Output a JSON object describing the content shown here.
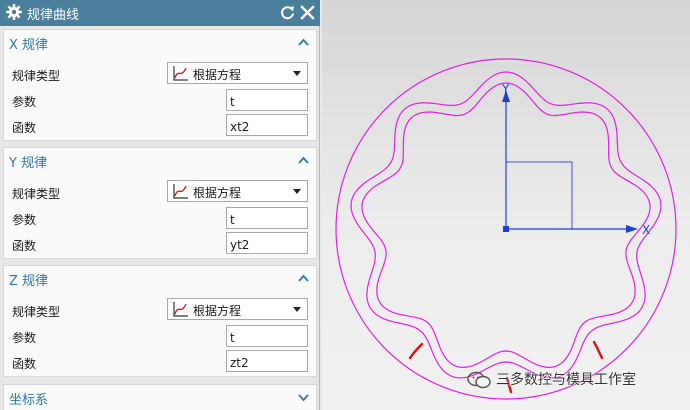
{
  "dialog": {
    "title": "规律曲线",
    "icons": {
      "settings": "gear-icon",
      "reset": "reset-icon",
      "close": "close-icon"
    }
  },
  "sections": [
    {
      "title": "X 规律",
      "law_type_label": "规律类型",
      "law_type_value": "根据方程",
      "param_label": "参数",
      "param_value": "t",
      "func_label": "函数",
      "func_value": "xt2"
    },
    {
      "title": "Y 规律",
      "law_type_label": "规律类型",
      "law_type_value": "根据方程",
      "param_label": "参数",
      "param_value": "t",
      "func_label": "函数",
      "func_value": "yt2"
    },
    {
      "title": "Z 规律",
      "law_type_label": "规律类型",
      "law_type_value": "根据方程",
      "param_label": "参数",
      "param_value": "t",
      "func_label": "函数",
      "func_value": "zt2"
    }
  ],
  "coord_section": {
    "title": "坐标系"
  },
  "viewport": {
    "axis_x_label": "X",
    "axis_y_label": "Y",
    "colors": {
      "curve": "#e020e0",
      "axis": "#1f3fd8",
      "mark": "#e01010"
    }
  },
  "watermark": {
    "text": "三多数控与模具工作室"
  },
  "colors": {
    "titlebar": "#4a7f9b",
    "section_title": "#2b77b3"
  }
}
